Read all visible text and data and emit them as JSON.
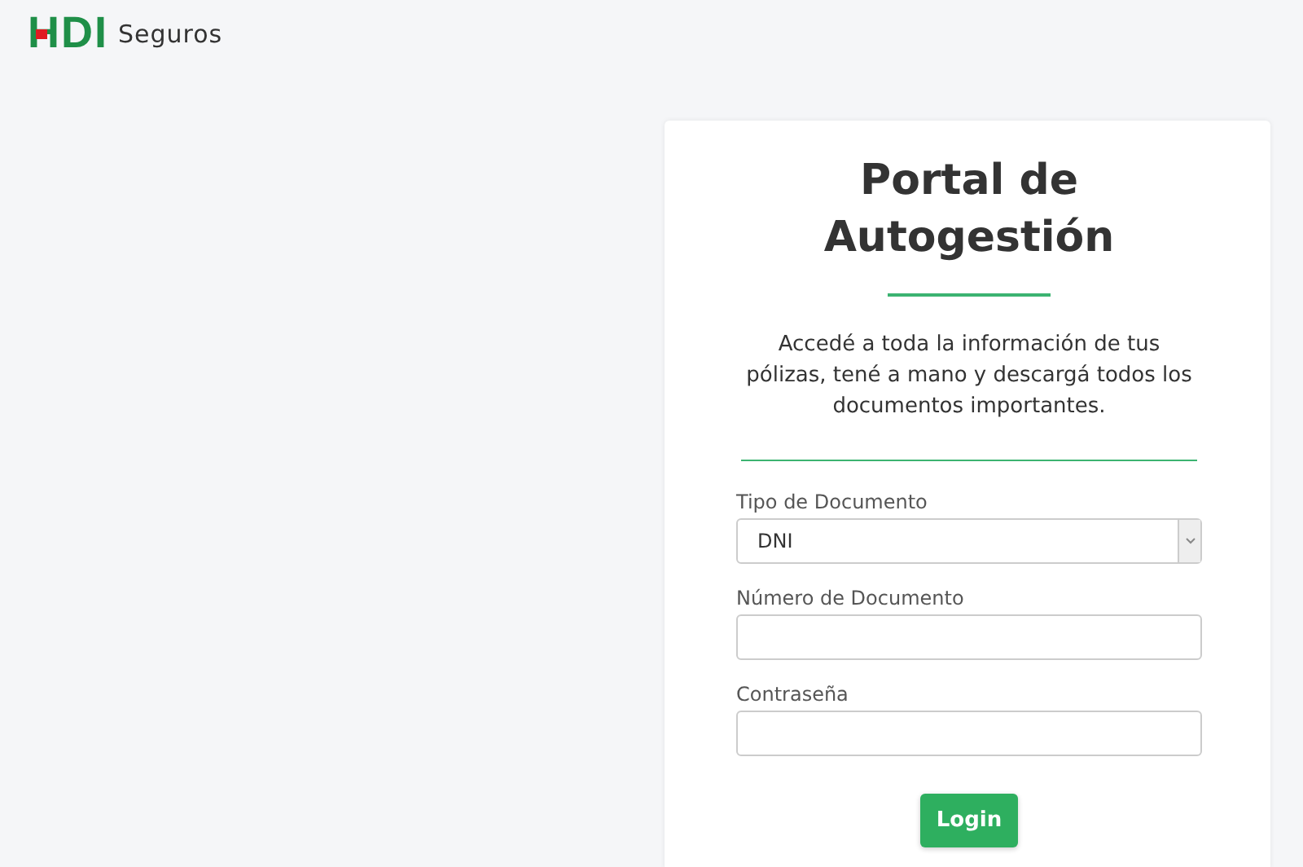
{
  "brand": {
    "logo": "HDI",
    "name": "Seguros"
  },
  "card": {
    "title": "Portal de Autogestión",
    "description": "Accedé a toda la información de tus pólizas, tené a mano y descargá todos los documentos importantes.",
    "fields": [
      {
        "kind": "select",
        "label": "Tipo de Documento",
        "value": "DNI"
      },
      {
        "kind": "text",
        "label": "Número de Documento"
      },
      {
        "kind": "password",
        "label": "Contraseña"
      }
    ],
    "button": "Login"
  }
}
